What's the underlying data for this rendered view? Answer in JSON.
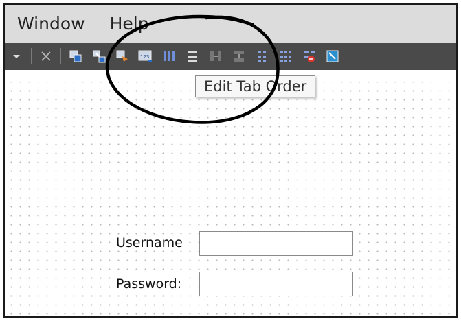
{
  "menubar": {
    "items": [
      {
        "label": "Window"
      },
      {
        "label": "Help"
      }
    ]
  },
  "toolbar": {
    "buttons": [
      {
        "icon": "dropdown-arrow-icon"
      },
      {
        "icon": "close-icon"
      },
      {
        "icon": "edit-widgets-icon"
      },
      {
        "icon": "edit-signals-slots-icon"
      },
      {
        "icon": "edit-buddies-icon"
      },
      {
        "icon": "edit-tab-order-icon"
      },
      {
        "icon": "layout-horizontal-icon"
      },
      {
        "icon": "layout-vertical-icon"
      },
      {
        "icon": "layout-horizontal-splitter-icon"
      },
      {
        "icon": "layout-vertical-splitter-icon"
      },
      {
        "icon": "layout-form-icon"
      },
      {
        "icon": "layout-grid-icon"
      },
      {
        "icon": "break-layout-icon"
      },
      {
        "icon": "adjust-size-icon"
      }
    ]
  },
  "tooltip": {
    "text": "Edit Tab Order"
  },
  "form": {
    "username_label": "Username",
    "password_label": "Password:",
    "username_value": "",
    "password_value": ""
  },
  "colors": {
    "menubar_bg": "#dcdcdc",
    "toolbar_bg": "#4a4a4a",
    "annotation_circle": "#000000"
  }
}
